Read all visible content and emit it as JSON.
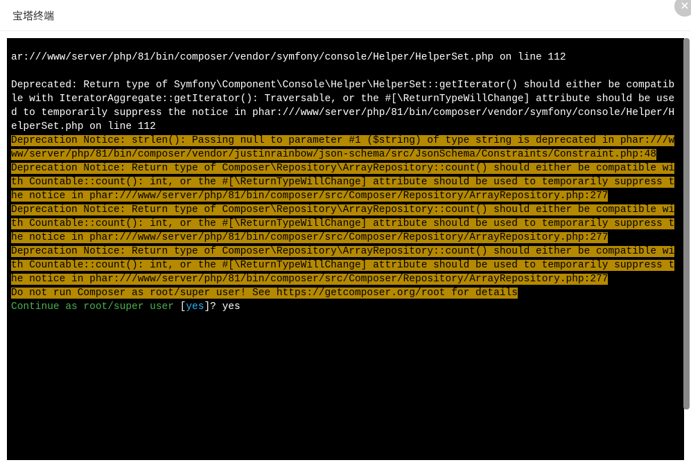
{
  "titlebar": {
    "title": "宝塔终端"
  },
  "close": {
    "glyph": "✕"
  },
  "terminal": {
    "line1": "ar:///www/server/php/81/bin/composer/vendor/symfony/console/Helper/HelperSet.php on line 112",
    "blank1": "",
    "line2": "Deprecated: Return type of Symfony\\Component\\Console\\Helper\\HelperSet::getIterator() should either be compatible with IteratorAggregate::getIterator(): Traversable, or the #[\\ReturnTypeWillChange] attribute should be used to temporarily suppress the notice in phar:///www/server/php/81/bin/composer/vendor/symfony/console/Helper/HelperSet.php on line 112",
    "hl1": "Deprecation Notice: strlen(): Passing null to parameter #1 ($string) of type string is deprecated in phar:///www/server/php/81/bin/composer/vendor/justinrainbow/json-schema/src/JsonSchema/Constraints/Constraint.php:48",
    "hl2": "Deprecation Notice: Return type of Composer\\Repository\\ArrayRepository::count() should either be compatible with Countable::count(): int, or the #[\\ReturnTypeWillChange] attribute should be used to temporarily suppress the notice in phar:///www/server/php/81/bin/composer/src/Composer/Repository/ArrayRepository.php:277",
    "hl3": "Deprecation Notice: Return type of Composer\\Repository\\ArrayRepository::count() should either be compatible with Countable::count(): int, or the #[\\ReturnTypeWillChange] attribute should be used to temporarily suppress the notice in phar:///www/server/php/81/bin/composer/src/Composer/Repository/ArrayRepository.php:277",
    "hl4": "Deprecation Notice: Return type of Composer\\Repository\\ArrayRepository::count() should either be compatible with Countable::count(): int, or the #[\\ReturnTypeWillChange] attribute should be used to temporarily suppress the notice in phar:///www/server/php/81/bin/composer/src/Composer/Repository/ArrayRepository.php:277",
    "hl5": "Do not run Composer as root/super user! See https://getcomposer.org/root for details",
    "prompt_prefix": "Continue as root/super user",
    "prompt_space": " [",
    "prompt_yes": "yes",
    "prompt_suffix": "]? yes"
  }
}
